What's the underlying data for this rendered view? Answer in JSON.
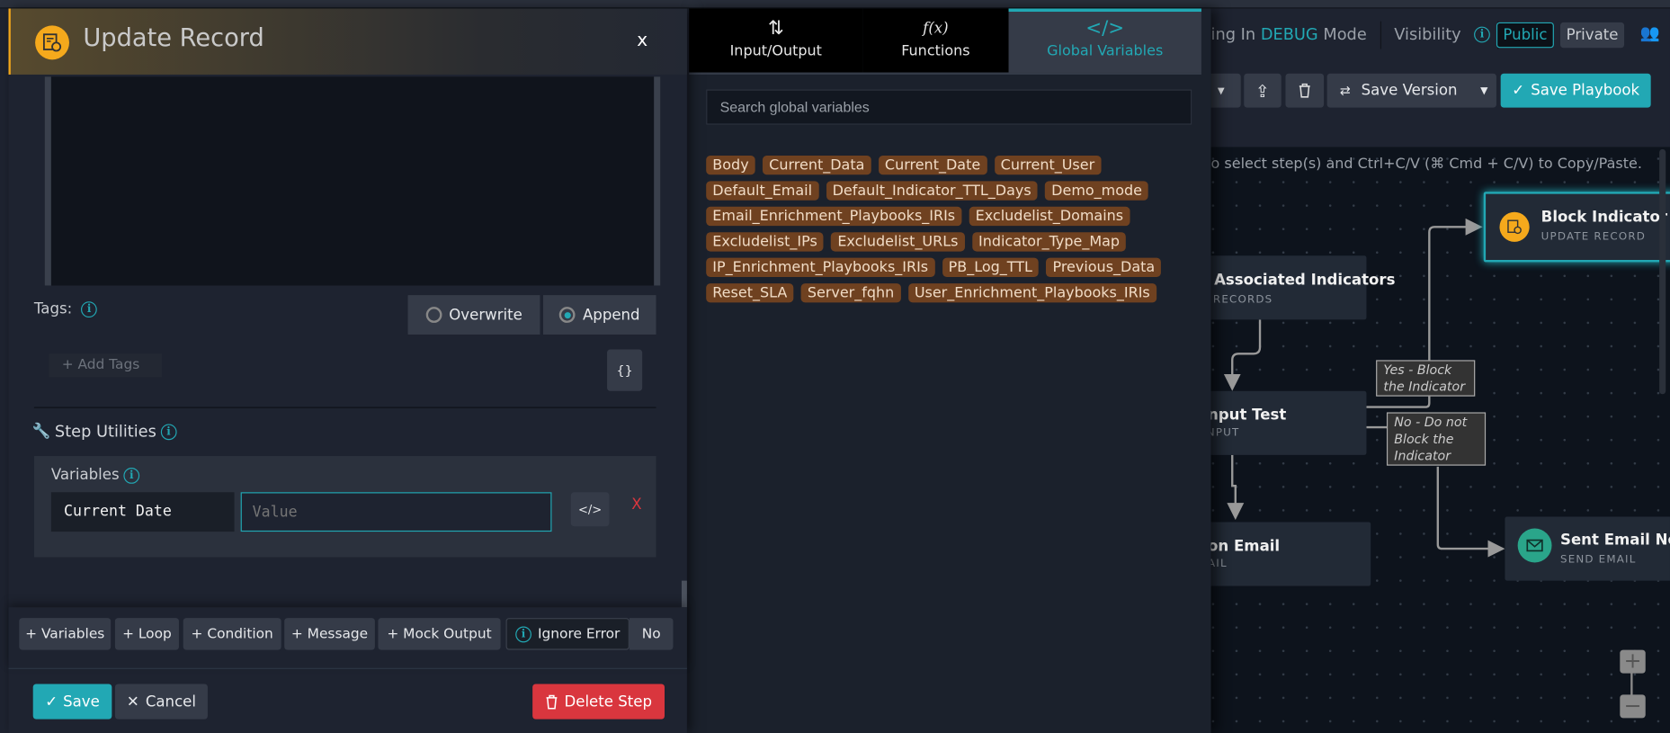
{
  "dialog": {
    "title": "Update Record",
    "close_label": "x",
    "tags": {
      "label": "Tags:",
      "mode_options": [
        "Overwrite",
        "Append"
      ],
      "selected_mode": "Append",
      "add_tags_placeholder": "+ Add Tags",
      "json_button": "{}"
    },
    "step_utilities": {
      "title": "Step Utilities",
      "variables_label": "Variables",
      "variable_name": "Current Date",
      "variable_value_placeholder": "Value",
      "code_button": "</>",
      "remove_label": "X"
    },
    "utility_buttons": [
      "+ Variables",
      "+ Loop",
      "+ Condition",
      "+ Message",
      "+ Mock Output"
    ],
    "ignore_error": {
      "label": "Ignore Error",
      "value": "No"
    },
    "save_label": "Save",
    "cancel_label": "Cancel",
    "delete_label": "Delete Step"
  },
  "picker": {
    "tabs": [
      {
        "glyph": "⇅",
        "label": "Input/Output"
      },
      {
        "glyph": "f(x)",
        "label": "Functions"
      },
      {
        "glyph": "</>",
        "label": "Global Variables"
      }
    ],
    "active_tab": "Global Variables",
    "search_placeholder": "Search global variables",
    "variables": [
      "Body",
      "Current_Data",
      "Current_Date",
      "Current_User",
      "Default_Email",
      "Default_Indicator_TTL_Days",
      "Demo_mode",
      "Email_Enrichment_Playbooks_IRIs",
      "Excludelist_Domains",
      "Excludelist_IPs",
      "Excludelist_URLs",
      "Indicator_Type_Map",
      "IP_Enrichment_Playbooks_IRIs",
      "PB_Log_TTL",
      "Previous_Data",
      "Reset_SLA",
      "Server_fqhn",
      "User_Enrichment_Playbooks_IRIs"
    ]
  },
  "header": {
    "mode_prefix": "ing In",
    "mode_value": "DEBUG",
    "mode_suffix": "Mode",
    "visibility_label": "Visibility",
    "public_label": "Public",
    "private_label": "Private",
    "save_version_label": "Save Version",
    "save_playbook_label": "Save Playbook"
  },
  "canvas": {
    "hint": "o select step(s) and Ctrl+C/V (⌘ Cmd + C/V) to Copy/Paste.",
    "nodes": [
      {
        "title": "Associated Indicators",
        "subtitle": "RECORDS"
      },
      {
        "title": "nput Test",
        "subtitle": "NPUT"
      },
      {
        "title": "on Email",
        "subtitle": "AIL"
      },
      {
        "title": "Block Indicator",
        "subtitle": "UPDATE RECORD"
      },
      {
        "title": "Sent Email No",
        "subtitle": "SEND EMAIL"
      }
    ],
    "edge_labels": [
      "Yes - Block the Indicator",
      "No - Do not Block the Indicator"
    ],
    "zoom_in": "+",
    "zoom_out": "−"
  },
  "colors": {
    "accent": "#22a8b4",
    "tag_bg": "#6f4120",
    "danger": "#d9363e",
    "update_icon": "#f5a91c",
    "email_icon": "#2aa58a"
  }
}
